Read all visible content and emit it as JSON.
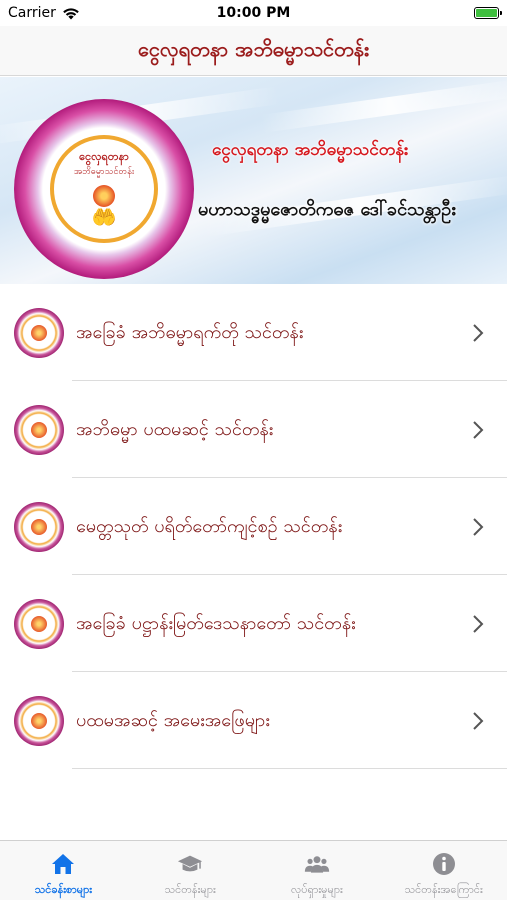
{
  "status_bar": {
    "carrier": "Carrier",
    "time": "10:00 PM"
  },
  "nav": {
    "title": "ငွေလှရတနာ အဘိဓမ္မာသင်တန်း"
  },
  "banner": {
    "logo_text_1": "ငွေလှရတနာ",
    "logo_text_2": "အဘိဓမ္မာသင်တန်း",
    "title": "ငွေလှရတနာ အဘိဓမ္မာသင်တန်း",
    "subtitle": "မဟာသဒ္ဓမ္မဇောတိကဓဇ ဒေါ်ခင်သန္တာဦး"
  },
  "list": {
    "items": [
      {
        "label": "အခြေခံ အဘိဓမ္မာရက်တို သင်တန်း"
      },
      {
        "label": "အဘိဓမ္မာ ပထမဆင့် သင်တန်း"
      },
      {
        "label": "မေတ္တသုတ် ပရိတ်တော်ကျင့်စဉ် သင်တန်း"
      },
      {
        "label": "အခြေခံ ပဋ္ဌာန်းမြတ်ဒေသနာတော် သင်တန်း"
      },
      {
        "label": "ပထမအဆင့် အမေးအဖြေများ"
      }
    ]
  },
  "tabs": [
    {
      "label": "သင်ခန်းစာများ",
      "icon": "home-icon",
      "active": true
    },
    {
      "label": "သင်တန်းများ",
      "icon": "graduation-cap-icon",
      "active": false
    },
    {
      "label": "လုပ်ရှားမှုများ",
      "icon": "group-icon",
      "active": false
    },
    {
      "label": "သင်တန်းအကြောင်း",
      "icon": "info-icon",
      "active": false
    }
  ],
  "colors": {
    "accent_active_tab": "#1273e8",
    "title_maroon": "#9b1c1c",
    "inactive_tab": "#8e8e93"
  }
}
